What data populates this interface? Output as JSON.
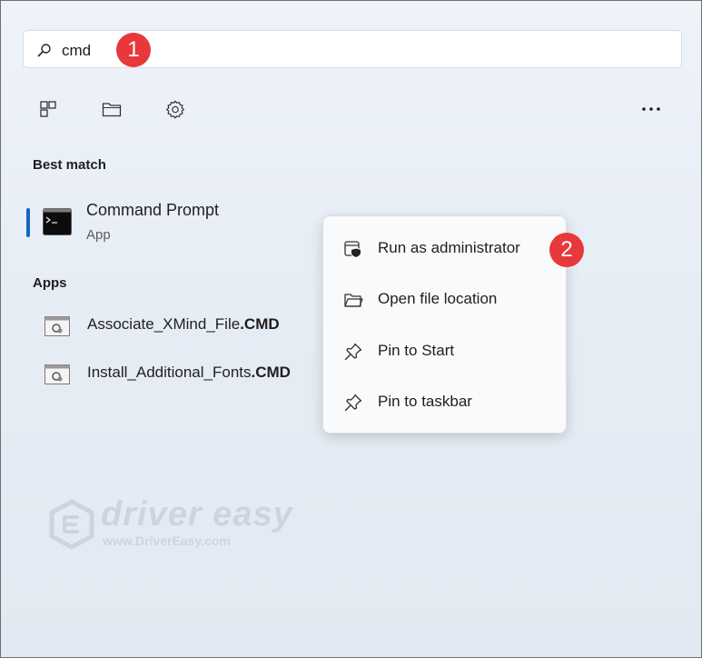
{
  "search": {
    "value": "cmd"
  },
  "badges": {
    "step1": "1",
    "step2": "2"
  },
  "toolbar": {
    "icons": [
      "widgets-icon",
      "folder-icon",
      "gear-icon",
      "more-icon"
    ],
    "more_label": "..."
  },
  "best_match": {
    "heading": "Best match",
    "item": {
      "title": "Command Prompt",
      "subtitle": "App",
      "icon": "cmd-icon"
    }
  },
  "apps": {
    "heading": "Apps",
    "items": [
      {
        "name": "Associate_XMind_File",
        "ext": ".CMD",
        "icon": "script-icon"
      },
      {
        "name": "Install_Additional_Fonts",
        "ext": ".CMD",
        "icon": "script-icon"
      }
    ]
  },
  "context_menu": {
    "items": [
      {
        "label": "Run as administrator",
        "icon": "shield-icon"
      },
      {
        "label": "Open file location",
        "icon": "folder-icon"
      },
      {
        "label": "Pin to Start",
        "icon": "pin-icon"
      },
      {
        "label": "Pin to taskbar",
        "icon": "pin-icon"
      }
    ]
  },
  "watermark": {
    "name": "driver easy",
    "url": "www.DriverEasy.com"
  },
  "colors": {
    "accent": "#1565c0",
    "badge": "#e8383b",
    "menu_bg": "#f9fafb"
  }
}
